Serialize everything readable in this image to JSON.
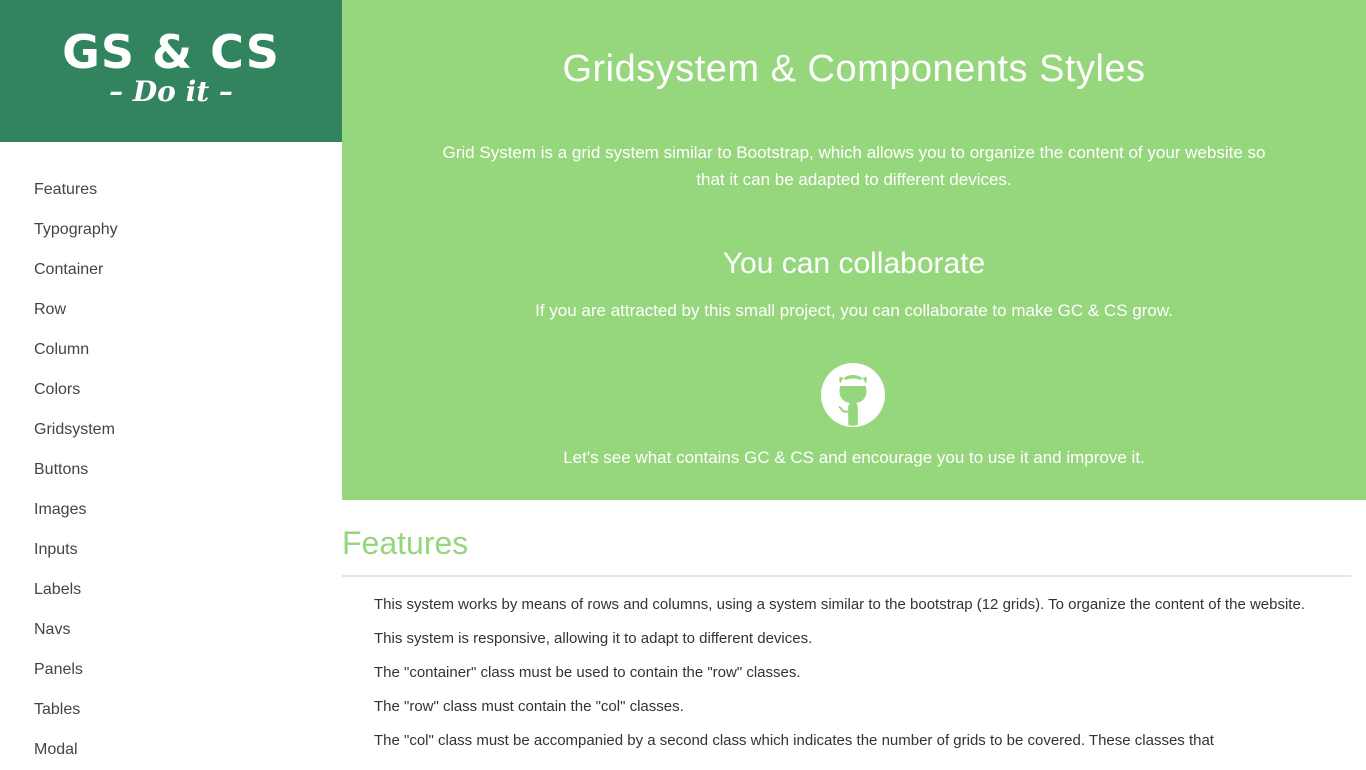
{
  "logo": {
    "title": "GS & CS",
    "subtitle": "– Do it –"
  },
  "sidebar": {
    "items": [
      {
        "label": "Features"
      },
      {
        "label": "Typography"
      },
      {
        "label": "Container"
      },
      {
        "label": "Row"
      },
      {
        "label": "Column"
      },
      {
        "label": "Colors"
      },
      {
        "label": "Gridsystem"
      },
      {
        "label": "Buttons"
      },
      {
        "label": "Images"
      },
      {
        "label": "Inputs"
      },
      {
        "label": "Labels"
      },
      {
        "label": "Navs"
      },
      {
        "label": "Panels"
      },
      {
        "label": "Tables"
      },
      {
        "label": "Modal"
      }
    ]
  },
  "hero": {
    "title": "Gridsystem & Components Styles",
    "intro": "Grid System is a grid system similar to Bootstrap, which allows you to organize the content of your website so that it can be adapted to different devices.",
    "collab_title": "You can collaborate",
    "collab_text": "If you are attracted by this small project, you can collaborate to make GC & CS grow.",
    "github_icon": "github-icon",
    "lets_text": "Let's see what contains GC & CS and encourage you to use it and improve it."
  },
  "features": {
    "title": "Features",
    "paragraphs": [
      "This system works by means of rows and columns, using a system similar to the bootstrap (12 grids). To organize the content of the website.",
      "This system is responsive, allowing it to adapt to different devices.",
      "The \"container\" class must be used to contain the \"row\" classes.",
      "The \"row\" class must contain the \"col\" classes.",
      "The \"col\" class must be accompanied by a second class which indicates the number of grids to be covered. These classes that"
    ]
  },
  "colors": {
    "brand_dark": "#31845d",
    "hero_green": "#96d67c"
  }
}
